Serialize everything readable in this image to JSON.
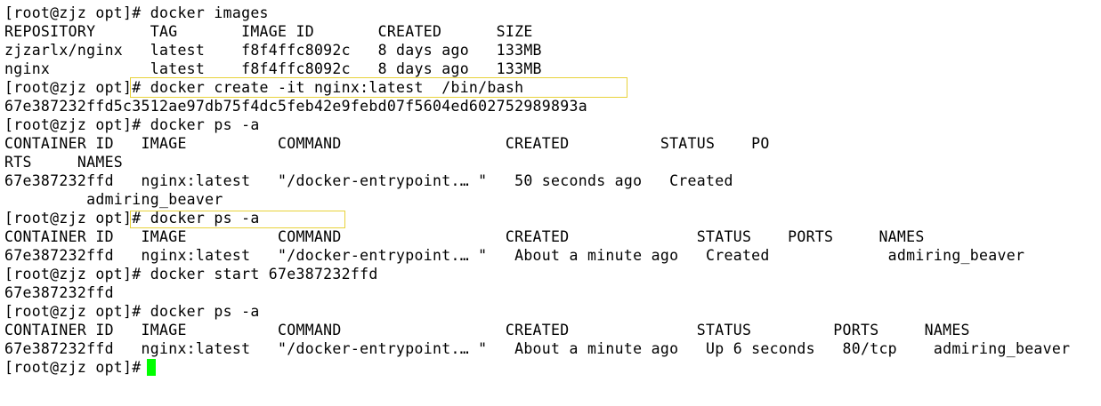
{
  "colors": {
    "background": "#ffffff",
    "text": "#000000",
    "highlight_box": "#e8d23a",
    "cursor": "#00ff00"
  },
  "terminal": {
    "lines": [
      "[root@zjz opt]# docker images",
      "REPOSITORY      TAG       IMAGE ID       CREATED      SIZE",
      "zjzarlx/nginx   latest    f8f4ffc8092c   8 days ago   133MB",
      "nginx           latest    f8f4ffc8092c   8 days ago   133MB",
      "[root@zjz opt]# docker create -it nginx:latest  /bin/bash",
      "67e387232ffd5c3512ae97db75f4dc5feb42e9febd07f5604ed602752989893a",
      "[root@zjz opt]# docker ps -a",
      "CONTAINER ID   IMAGE          COMMAND                  CREATED          STATUS    PO",
      "RTS     NAMES",
      "67e387232ffd   nginx:latest   \"/docker-entrypoint.… \"   50 seconds ago   Created",
      "         admiring_beaver",
      "[root@zjz opt]# docker ps -a",
      "CONTAINER ID   IMAGE          COMMAND                  CREATED              STATUS    PORTS     NAMES",
      "67e387232ffd   nginx:latest   \"/docker-entrypoint.… \"   About a minute ago   Created             admiring_beaver",
      "[root@zjz opt]# docker start 67e387232ffd",
      "67e387232ffd",
      "[root@zjz opt]# docker ps -a",
      "CONTAINER ID   IMAGE          COMMAND                  CREATED              STATUS         PORTS     NAMES",
      "67e387232ffd   nginx:latest   \"/docker-entrypoint.… \"   About a minute ago   Up 6 seconds   80/tcp    admiring_beaver",
      "[root@zjz opt]# "
    ]
  }
}
